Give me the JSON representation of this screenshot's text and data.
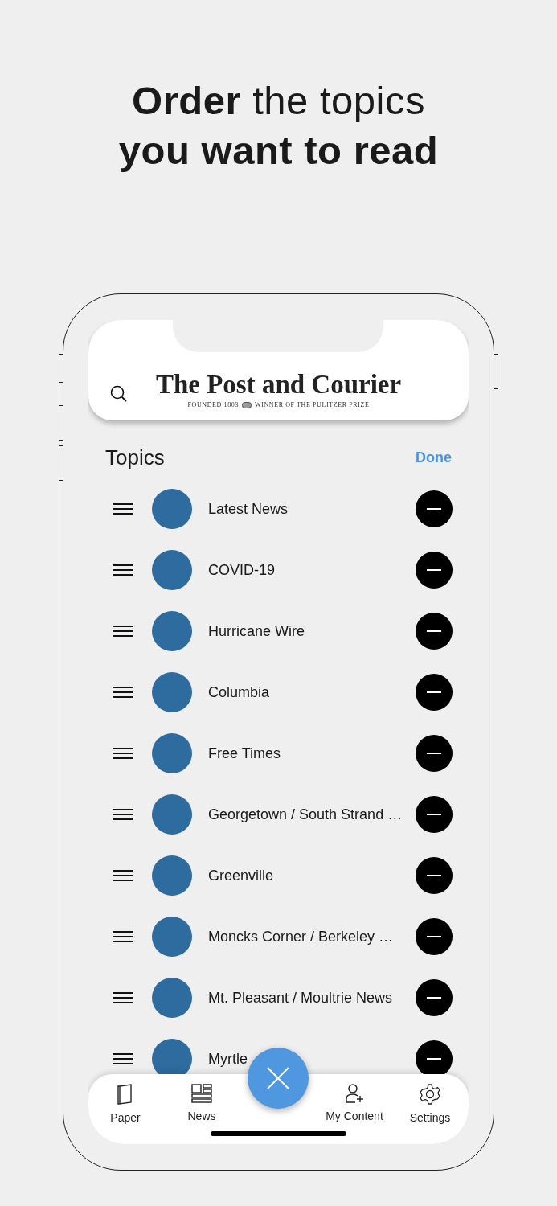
{
  "headline": [
    {
      "text": "**Order** the topics",
      "bold": false
    },
    {
      "text": "you want to read",
      "bold": true
    }
  ],
  "header": {
    "logo": "The Post and Courier",
    "tagline_left": "FOUNDED 1803",
    "tagline_right": "WINNER OF THE PULITZER PRIZE"
  },
  "topics": {
    "title": "Topics",
    "done": "Done"
  },
  "items": [
    {
      "label": "Latest News"
    },
    {
      "label": "COVID-19"
    },
    {
      "label": "Hurricane Wire"
    },
    {
      "label": "Columbia"
    },
    {
      "label": "Free Times"
    },
    {
      "label": "Georgetown / South Strand …"
    },
    {
      "label": "Greenville"
    },
    {
      "label": "Moncks Corner / Berkeley …"
    },
    {
      "label": "Mt. Pleasant / Moultrie News"
    },
    {
      "label": "Myrtle"
    }
  ],
  "tab_bar": [
    {
      "label": "Paper",
      "kind": "paper"
    },
    {
      "label": "News",
      "kind": "news"
    },
    {
      "label": "My Content",
      "kind": "person"
    },
    {
      "label": "Settings",
      "kind": "gear"
    }
  ]
}
